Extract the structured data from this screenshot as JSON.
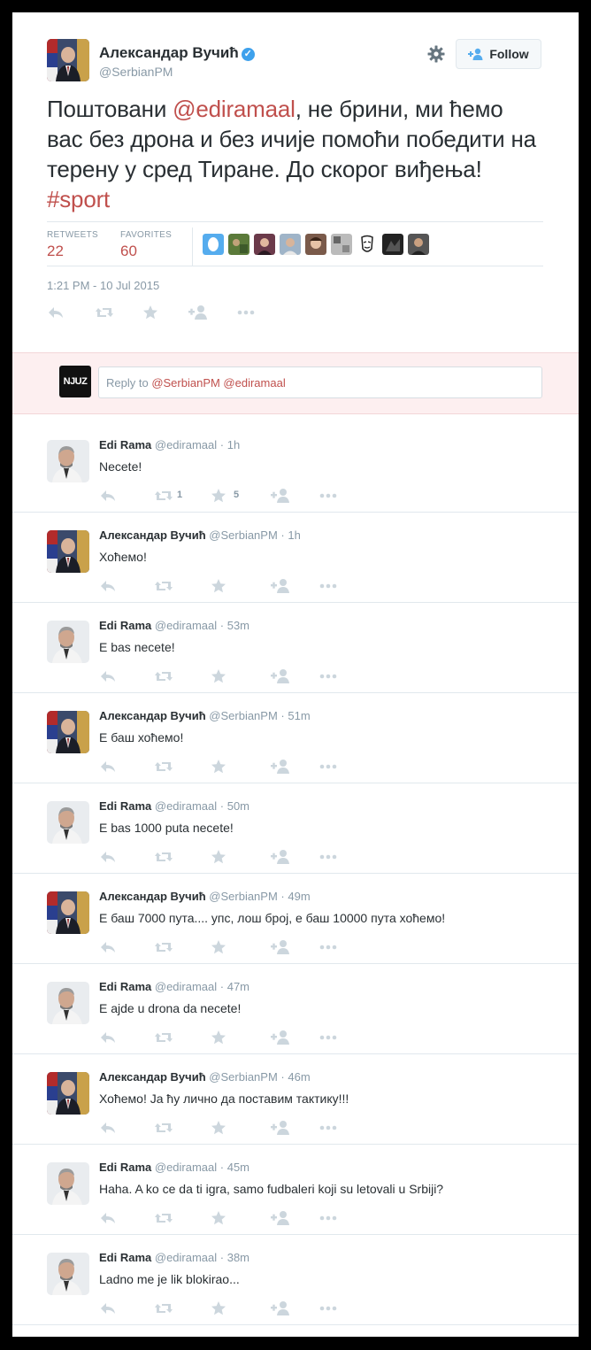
{
  "tweet": {
    "author_name": "Александар Вучић",
    "author_handle": "@SerbianPM",
    "follow_label": "Follow",
    "text_part1": "Поштовани ",
    "mention": "@ediramaal",
    "text_part2": ", не брини, ми ћемо вас без дрона и без ичије помоћи победити на терену у сред Тиране. До скорог виђења! ",
    "hashtag": "#sport",
    "retweets_label": "RETWEETS",
    "retweets_count": "22",
    "favorites_label": "FAVORITES",
    "favorites_count": "60",
    "timestamp": "1:21 PM - 10 Jul 2015"
  },
  "reply_box": {
    "avatar_text": "NJUZ",
    "prompt": "Reply to ",
    "mentions": "@SerbianPM @ediramaal"
  },
  "replies": [
    {
      "name": "Edi Rama",
      "handle": "@ediramaal",
      "time": "1h",
      "text": "Necete!",
      "retweets": "1",
      "favorites": "5",
      "avatar": "rama"
    },
    {
      "name": "Александар Вучић",
      "handle": "@SerbianPM",
      "time": "1h",
      "text": "Хоћемо!",
      "retweets": "",
      "favorites": "",
      "avatar": "vucic"
    },
    {
      "name": "Edi Rama",
      "handle": "@ediramaal",
      "time": "53m",
      "text": "E bas necete!",
      "retweets": "",
      "favorites": "",
      "avatar": "rama"
    },
    {
      "name": "Александар Вучић",
      "handle": "@SerbianPM",
      "time": "51m",
      "text": "Е баш хоћемо!",
      "retweets": "",
      "favorites": "",
      "avatar": "vucic"
    },
    {
      "name": "Edi Rama",
      "handle": "@ediramaal",
      "time": "50m",
      "text": "E bas 1000 puta necete!",
      "retweets": "",
      "favorites": "",
      "avatar": "rama"
    },
    {
      "name": "Александар Вучић",
      "handle": "@SerbianPM",
      "time": "49m",
      "text": "Е баш 7000 пута.... упс, лош број, е баш 10000 пута хоћемо!",
      "retweets": "",
      "favorites": "",
      "avatar": "vucic"
    },
    {
      "name": "Edi Rama",
      "handle": "@ediramaal",
      "time": "47m",
      "text": "E ajde u drona da necete!",
      "retweets": "",
      "favorites": "",
      "avatar": "rama"
    },
    {
      "name": "Александар Вучић",
      "handle": "@SerbianPM",
      "time": "46m",
      "text": "Хоћемо! Ја ћу лично да поставим тактику!!!",
      "retweets": "",
      "favorites": "",
      "avatar": "vucic"
    },
    {
      "name": "Edi Rama",
      "handle": "@ediramaal",
      "time": "45m",
      "text": "Haha. A ko ce da ti igra, samo fudbaleri koji su letovali u Srbiji?",
      "retweets": "",
      "favorites": "",
      "avatar": "rama"
    },
    {
      "name": "Edi Rama",
      "handle": "@ediramaal",
      "time": "38m",
      "text": "Ladno me je lik blokirao...",
      "retweets": "",
      "favorites": "",
      "avatar": "rama"
    }
  ],
  "favoriters": [
    "oval-avatar",
    "photo-avatar",
    "photo-avatar",
    "photo-avatar",
    "photo-avatar",
    "photo-avatar",
    "mask-avatar",
    "photo-avatar",
    "photo-avatar"
  ],
  "colors": {
    "accent": "#c0504d",
    "muted": "#8899a6",
    "verified": "#3ea1ec",
    "reply_bg": "#fdeff0"
  }
}
